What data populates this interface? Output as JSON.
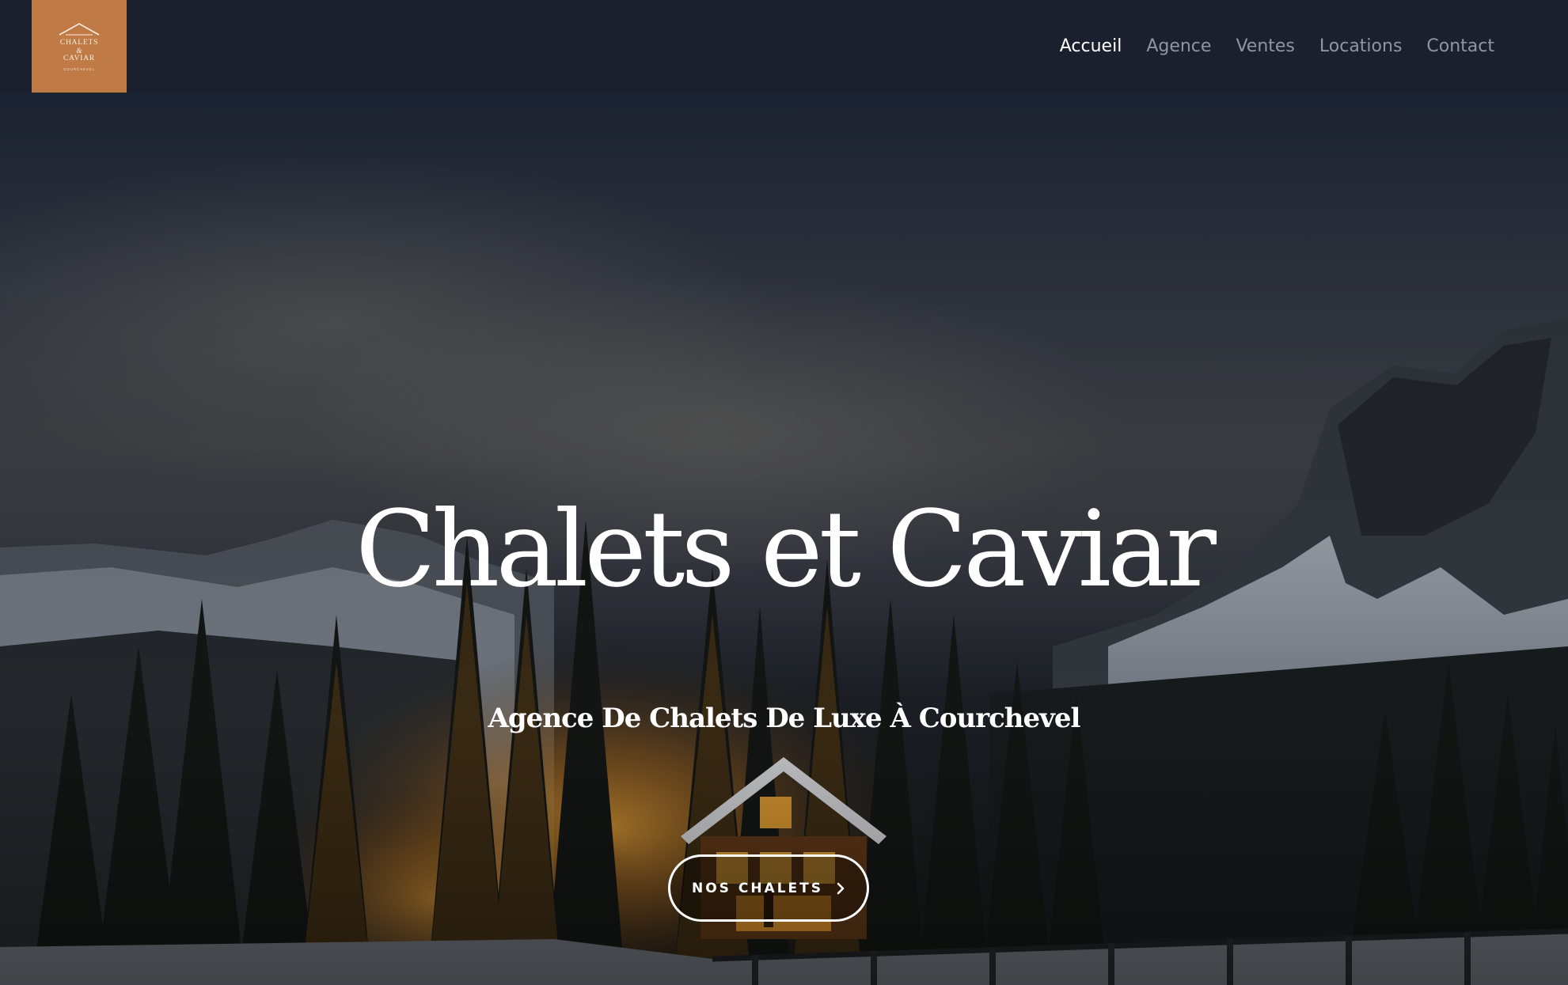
{
  "brand": {
    "logo_line1": "CHALETS",
    "logo_line2": "&",
    "logo_line3": "CAVIAR",
    "logo_line4": "COURCHEVEL",
    "logo_color": "#c07a45"
  },
  "nav": {
    "items": [
      {
        "label": "Accueil",
        "active": true
      },
      {
        "label": "Agence",
        "active": false
      },
      {
        "label": "Ventes",
        "active": false
      },
      {
        "label": "Locations",
        "active": false
      },
      {
        "label": "Contact",
        "active": false
      }
    ]
  },
  "hero": {
    "title": "Chalets et Caviar",
    "subtitle": "Agence De Chalets De Luxe À Courchevel",
    "cta_label": "NOS CHALETS",
    "cta_icon": "chevron-right-icon"
  },
  "colors": {
    "navbar_bg": "#1b202e",
    "nav_active": "#ffffff",
    "nav_inactive": "#8e96a6"
  }
}
